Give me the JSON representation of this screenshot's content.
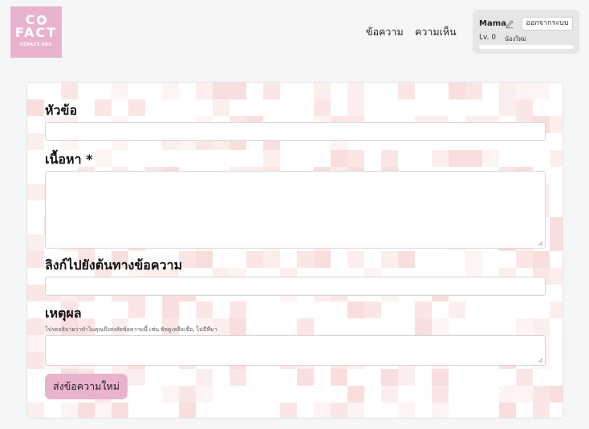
{
  "logo": {
    "line1": "CO FACT",
    "line2": "FACT",
    "line3": "COFACT.ORG"
  },
  "nav": {
    "posts": "ข้อความ",
    "replies": "ความเห็น"
  },
  "user": {
    "name": "Mama",
    "logout": "ออกจากระบบ",
    "level": "Lv. 0",
    "title": "น้องใหม่",
    "progress": 0.0
  },
  "form": {
    "title_label": "หัวข้อ",
    "content_label": "เนื้อหา *",
    "url_label": "ลิงก์ไปยังต้นทางข้อความ",
    "reason_label": "เหตุผล",
    "reason_hint": "โปรดอธิบายว่าทำไมคุณถึงสงสัยข้อความนี้ เช่น พิจดูเหลือเชื่อ, ไม่มีที่มา",
    "submit": "ส่งข้อความใหม่"
  },
  "colors": {
    "brand": "#e9b3cf"
  },
  "icons": {
    "edit": "pencil-icon"
  }
}
